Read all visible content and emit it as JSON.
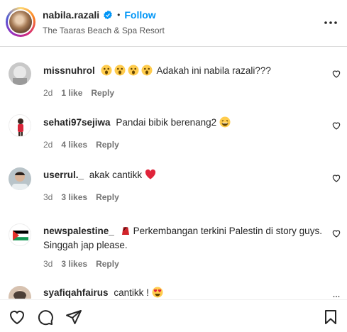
{
  "post": {
    "username": "nabila.razali",
    "dot": "•",
    "follow_label": "Follow",
    "location": "The Taaras Beach & Spa Resort"
  },
  "comments": [
    {
      "username": "missnuhrol",
      "text": "Adakah ini nabila razali???",
      "time": "2d",
      "likes": "1 like",
      "reply": "Reply"
    },
    {
      "username": "sehati97sejiwa",
      "text": "Pandai bibik berenang2",
      "time": "2d",
      "likes": "4 likes",
      "reply": "Reply"
    },
    {
      "username": "userrul._",
      "text": "akak cantikk",
      "time": "3d",
      "likes": "3 likes",
      "reply": "Reply"
    },
    {
      "username": "newspalestine_",
      "text": "Perkembangan terkini Palestin di story guys. Singgah jap please.",
      "time": "3d",
      "likes": "3 likes",
      "reply": "Reply"
    },
    {
      "username": "syafiqahfairus",
      "text": "cantikk !"
    }
  ],
  "icons": {
    "verified": "verified-badge-icon",
    "more": "more-horizontal-icon",
    "like": "heart-icon",
    "comment": "comment-icon",
    "share": "send-icon",
    "save": "bookmark-icon"
  },
  "colors": {
    "accent": "#0095f6",
    "verified": "#0095f6",
    "heart_red": "#ed4956",
    "meta": "#737373"
  }
}
